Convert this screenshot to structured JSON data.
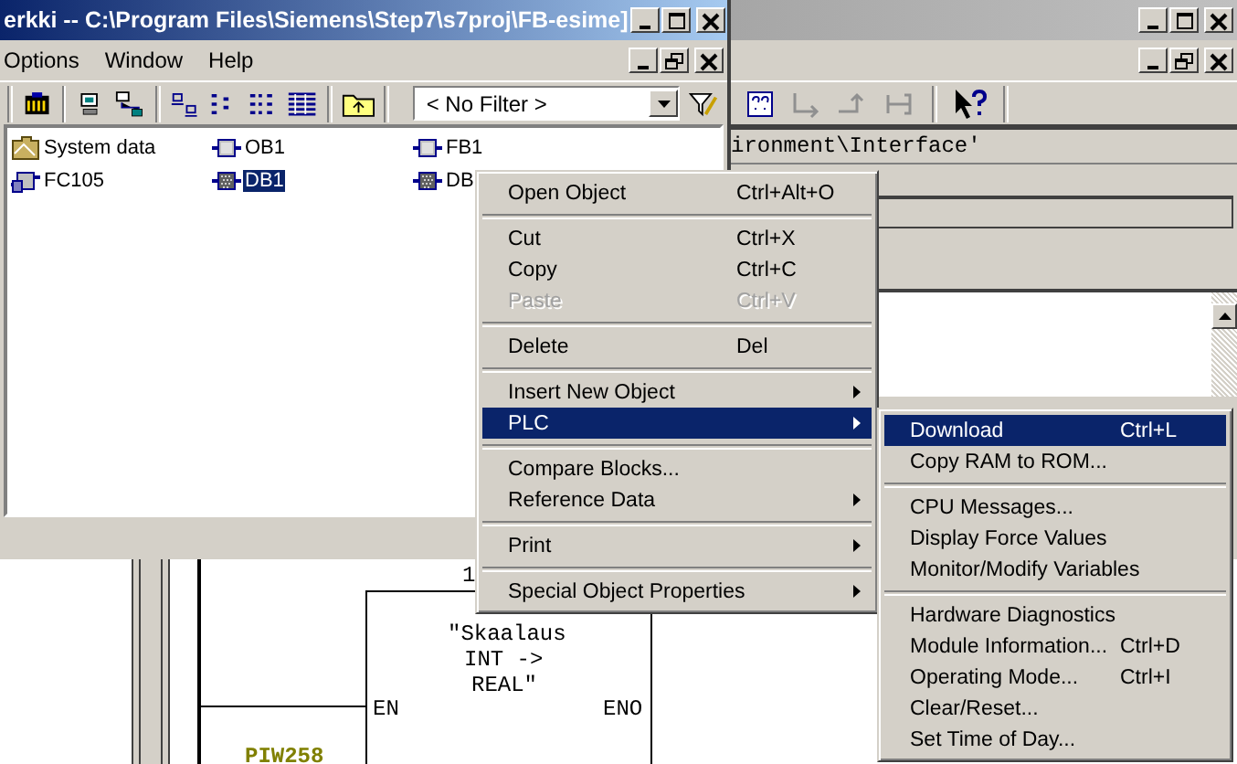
{
  "editor_window": {
    "address": "ironment\\Interface'",
    "network": {
      "top_label": "1",
      "block_comment": [
        "\"Skaalaus",
        "INT ->",
        "REAL\""
      ],
      "input_pin": "EN",
      "output_pin": "ENO",
      "operand": "PIW258"
    }
  },
  "manager_window": {
    "title": "erkki -- C:\\Program Files\\Siemens\\Step7\\s7proj\\FB-esime]",
    "menu_bar": [
      "Options",
      "Window",
      "Help"
    ],
    "filter": {
      "value": "< No Filter >"
    },
    "objects": [
      {
        "label": "System data",
        "kind": "folder",
        "selected": false
      },
      {
        "label": "OB1",
        "kind": "block",
        "selected": false
      },
      {
        "label": "FB1",
        "kind": "block",
        "selected": false
      },
      {
        "label": "FC105",
        "kind": "function",
        "selected": false
      },
      {
        "label": "DB1",
        "kind": "data-block",
        "selected": true
      },
      {
        "label": "DB",
        "kind": "data-block",
        "selected": false
      }
    ]
  },
  "context_menu": {
    "items": [
      {
        "kind": "item",
        "label": "Open Object",
        "shortcut": "Ctrl+Alt+O",
        "submenu": false,
        "disabled": false,
        "selected": false
      },
      {
        "kind": "separator"
      },
      {
        "kind": "item",
        "label": "Cut",
        "shortcut": "Ctrl+X",
        "submenu": false,
        "disabled": false,
        "selected": false
      },
      {
        "kind": "item",
        "label": "Copy",
        "shortcut": "Ctrl+C",
        "submenu": false,
        "disabled": false,
        "selected": false
      },
      {
        "kind": "item",
        "label": "Paste",
        "shortcut": "Ctrl+V",
        "submenu": false,
        "disabled": true,
        "selected": false
      },
      {
        "kind": "separator"
      },
      {
        "kind": "item",
        "label": "Delete",
        "shortcut": "Del",
        "submenu": false,
        "disabled": false,
        "selected": false
      },
      {
        "kind": "separator"
      },
      {
        "kind": "item",
        "label": "Insert New Object",
        "submenu": true,
        "disabled": false,
        "selected": false
      },
      {
        "kind": "item",
        "label": "PLC",
        "submenu": true,
        "disabled": false,
        "selected": true
      },
      {
        "kind": "separator"
      },
      {
        "kind": "item",
        "label": "Compare Blocks...",
        "submenu": false,
        "disabled": false,
        "selected": false
      },
      {
        "kind": "item",
        "label": "Reference Data",
        "submenu": true,
        "disabled": false,
        "selected": false
      },
      {
        "kind": "separator"
      },
      {
        "kind": "item",
        "label": "Print",
        "submenu": true,
        "disabled": false,
        "selected": false
      },
      {
        "kind": "separator"
      },
      {
        "kind": "item",
        "label": "Special Object Properties",
        "submenu": true,
        "disabled": false,
        "selected": false
      }
    ]
  },
  "submenu": {
    "items": [
      {
        "kind": "item",
        "label": "Download",
        "shortcut": "Ctrl+L",
        "submenu": false,
        "disabled": false,
        "selected": true
      },
      {
        "kind": "item",
        "label": "Copy RAM to ROM...",
        "submenu": false,
        "disabled": false,
        "selected": false
      },
      {
        "kind": "separator"
      },
      {
        "kind": "item",
        "label": "CPU Messages...",
        "submenu": false,
        "disabled": false,
        "selected": false
      },
      {
        "kind": "item",
        "label": "Display Force Values",
        "submenu": false,
        "disabled": false,
        "selected": false
      },
      {
        "kind": "item",
        "label": "Monitor/Modify Variables",
        "submenu": false,
        "disabled": false,
        "selected": false
      },
      {
        "kind": "separator"
      },
      {
        "kind": "item",
        "label": "Hardware Diagnostics",
        "submenu": false,
        "disabled": false,
        "selected": false
      },
      {
        "kind": "item",
        "label": "Module Information...",
        "shortcut": "Ctrl+D",
        "submenu": false,
        "disabled": false,
        "selected": false
      },
      {
        "kind": "item",
        "label": "Operating Mode...",
        "shortcut": "Ctrl+I",
        "submenu": false,
        "disabled": false,
        "selected": false
      },
      {
        "kind": "item",
        "label": "Clear/Reset...",
        "submenu": false,
        "disabled": false,
        "selected": false
      },
      {
        "kind": "item",
        "label": "Set Time of Day...",
        "submenu": false,
        "disabled": false,
        "selected": false
      }
    ]
  }
}
